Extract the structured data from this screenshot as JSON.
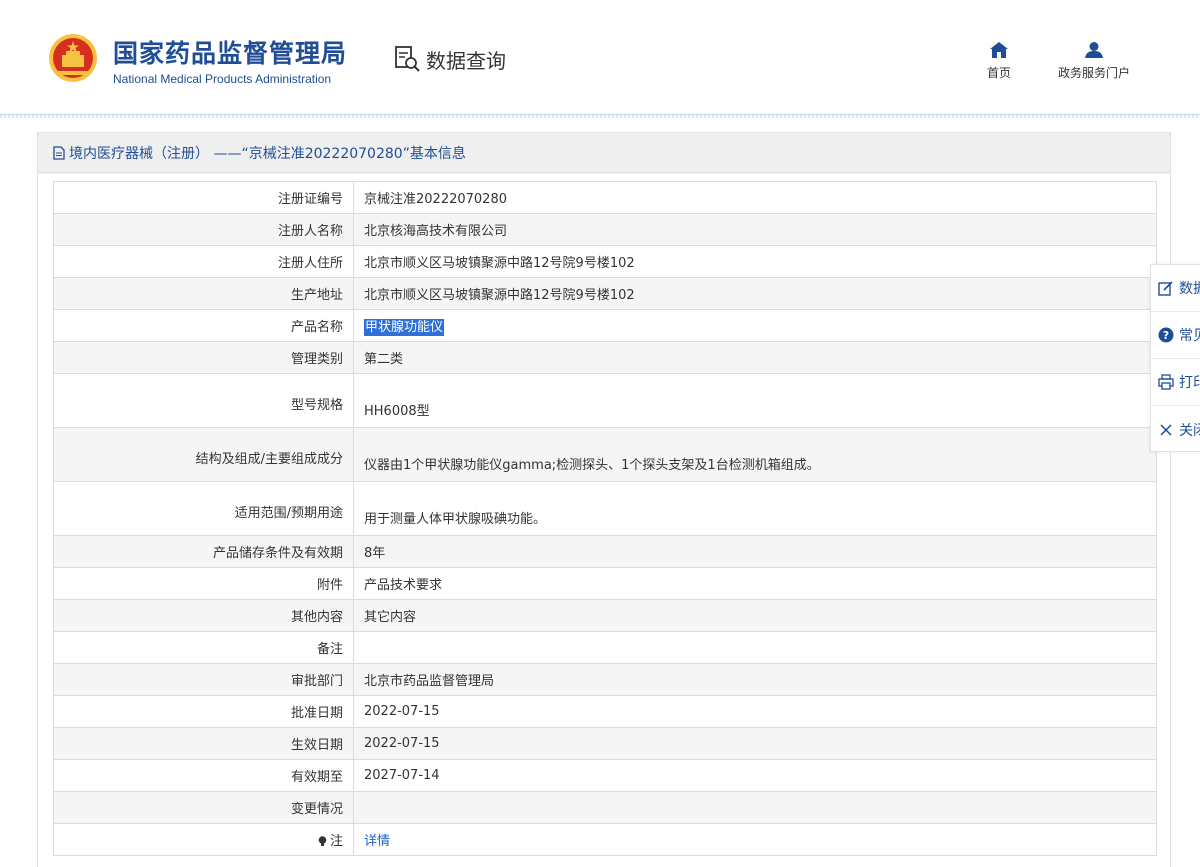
{
  "header": {
    "org_cn": "国家药品监督管理局",
    "org_en": "National Medical Products Administration",
    "section": "数据查询",
    "nav": [
      {
        "label": "首页",
        "icon": "home-icon"
      },
      {
        "label": "政务服务门户",
        "icon": "user-icon"
      }
    ]
  },
  "panel": {
    "title": "境内医疗器械（注册） ——“京械注准20222070280”基本信息"
  },
  "rows": [
    {
      "label": "注册证编号",
      "value": "京械注准20222070280"
    },
    {
      "label": "注册人名称",
      "value": "北京核海高技术有限公司"
    },
    {
      "label": "注册人住所",
      "value": "北京市顺义区马坡镇聚源中路12号院9号楼102"
    },
    {
      "label": "生产地址",
      "value": "北京市顺义区马坡镇聚源中路12号院9号楼102"
    },
    {
      "label": "产品名称",
      "value": "甲状腺功能仪"
    },
    {
      "label": "管理类别",
      "value": "第二类"
    },
    {
      "label": "型号规格",
      "value": "HH6008型"
    },
    {
      "label": "结构及组成/主要组成成分",
      "value": "仪器由1个甲状腺功能仪gamma;检测探头、1个探头支架及1台检测机箱组成。"
    },
    {
      "label": "适用范围/预期用途",
      "value": "用于测量人体甲状腺吸碘功能。"
    },
    {
      "label": "产品储存条件及有效期",
      "value": "8年"
    },
    {
      "label": "附件",
      "value": "产品技术要求"
    },
    {
      "label": "其他内容",
      "value": "其它内容"
    },
    {
      "label": "备注",
      "value": ""
    },
    {
      "label": "审批部门",
      "value": "北京市药品监督管理局"
    },
    {
      "label": "批准日期",
      "value": "2022-07-15"
    },
    {
      "label": "生效日期",
      "value": "2022-07-15"
    },
    {
      "label": "有效期至",
      "value": "2027-07-14"
    },
    {
      "label": "变更情况",
      "value": ""
    },
    {
      "label": "注",
      "value": "详情"
    }
  ],
  "float_menu": [
    {
      "label": "数据",
      "icon": "edit-icon"
    },
    {
      "label": "常见",
      "icon": "help-icon"
    },
    {
      "label": "打印",
      "icon": "print-icon"
    },
    {
      "label": "关闭",
      "icon": "close-icon"
    }
  ],
  "colors": {
    "brand": "#1f4e96",
    "highlight": "#2f6fd8",
    "link": "#1f61c9"
  }
}
